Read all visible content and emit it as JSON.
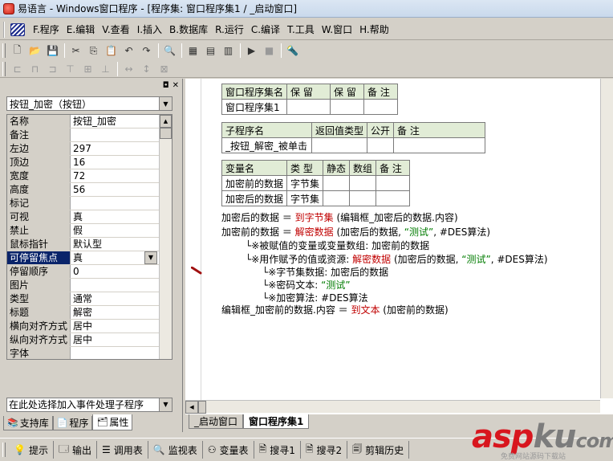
{
  "window": {
    "title": "易语言 - Windows窗口程序 - [程序集: 窗口程序集1 / _启动窗口]"
  },
  "menu": [
    "F.程序",
    "E.编辑",
    "V.查看",
    "I.插入",
    "B.数据库",
    "R.运行",
    "C.编译",
    "T.工具",
    "W.窗口",
    "H.帮助"
  ],
  "toolbar": {
    "row1": [
      "new-file-icon",
      "open-folder-icon",
      "save-icon",
      "cut-icon",
      "copy-icon",
      "paste-icon",
      "undo-icon",
      "redo-icon",
      "find-icon",
      "layout1-icon",
      "layout2-icon",
      "layout3-icon",
      "run-icon",
      "stop-icon",
      "debug-icon"
    ],
    "row1_glyphs": [
      "🗋",
      "📂",
      "💾",
      "✂",
      "⎘",
      "📋",
      "↶",
      "↷",
      "🔍",
      "▦",
      "▤",
      "▥",
      "▶",
      "■",
      "🔦"
    ],
    "row2": [
      "align-left-icon",
      "align-center-icon",
      "align-right-icon",
      "align-top-icon",
      "align-middle-icon",
      "align-bottom-icon",
      "same-width-icon",
      "same-height-icon",
      "same-size-icon"
    ],
    "row2_glyphs": [
      "⊏",
      "⊓",
      "⊐",
      "⊤",
      "⊞",
      "⊥",
      "↔",
      "↕",
      "⊠"
    ]
  },
  "left_panel": {
    "object_select": "按钮_加密（按钮）",
    "properties": [
      {
        "name": "名称",
        "value": "按钮_加密"
      },
      {
        "name": "备注",
        "value": ""
      },
      {
        "name": "左边",
        "value": "297"
      },
      {
        "name": "顶边",
        "value": "16"
      },
      {
        "name": "宽度",
        "value": "72"
      },
      {
        "name": "高度",
        "value": "56"
      },
      {
        "name": "标记",
        "value": ""
      },
      {
        "name": "可视",
        "value": "真"
      },
      {
        "name": "禁止",
        "value": "假"
      },
      {
        "name": "鼠标指针",
        "value": "默认型"
      },
      {
        "name": "可停留焦点",
        "value": "真",
        "selected": true
      },
      {
        "name": "  停留顺序",
        "value": "0"
      },
      {
        "name": "图片",
        "value": ""
      },
      {
        "name": "类型",
        "value": "通常"
      },
      {
        "name": "标题",
        "value": "解密"
      },
      {
        "name": "横向对齐方式",
        "value": "居中"
      },
      {
        "name": "纵向对齐方式",
        "value": "居中"
      },
      {
        "name": "字体",
        "value": ""
      }
    ],
    "event_select": "在此处选择加入事件处理子程序",
    "tabs": [
      {
        "label": "支持库",
        "icon": "library-icon",
        "glyph": "📚"
      },
      {
        "label": "程序",
        "icon": "program-icon",
        "glyph": "📄"
      },
      {
        "label": "属性",
        "icon": "property-icon",
        "glyph": "🗂"
      }
    ]
  },
  "code": {
    "table1": {
      "headers": [
        "窗口程序集名",
        "保 留",
        "保 留",
        "备 注"
      ],
      "row": [
        "窗口程序集1",
        "",
        "",
        ""
      ]
    },
    "table2": {
      "headers": [
        "子程序名",
        "返回值类型",
        "公开",
        "备 注"
      ],
      "row": [
        "_按钮_解密_被单击",
        "",
        "",
        ""
      ]
    },
    "table3": {
      "headers": [
        "变量名",
        "类 型",
        "静态",
        "数组",
        "备 注"
      ],
      "rows": [
        [
          "加密前的数据",
          "字节集",
          "",
          "",
          ""
        ],
        [
          "加密后的数据",
          "字节集",
          "",
          "",
          ""
        ]
      ]
    },
    "lines": [
      {
        "pre": "加密后的数据 ＝ ",
        "fn": "到字节集",
        "post": " (编辑框_加密后的数据.内容)"
      },
      {
        "pre": "加密前的数据 ＝ ",
        "fn": "解密数据",
        "post": " (加密后的数据, ",
        "str": "“测试”",
        "post2": ", #DES算法)"
      },
      {
        "tree": "└※被赋值的变量或变量数组: 加密前的数据"
      },
      {
        "tree": "└※用作赋予的值或资源: ",
        "fn": "解密数据",
        "post": " (加密后的数据, ",
        "str": "“测试”",
        "post2": ", #DES算法)"
      },
      {
        "tree": "※字节集数据: 加密后的数据"
      },
      {
        "tree": "※密码文本: ",
        "str": "“测试”"
      },
      {
        "tree": "※加密算法: #DES算法"
      },
      {
        "pre": "编辑框_加密前的数据.内容 ＝ ",
        "fn": "到文本",
        "post": " (加密前的数据)"
      }
    ],
    "tabs": [
      "_启动窗口",
      "窗口程序集1"
    ]
  },
  "bottom_tabs": [
    {
      "label": "提示",
      "icon": "tip-icon",
      "glyph": "💡"
    },
    {
      "label": "输出",
      "icon": "output-icon",
      "glyph": "🗔"
    },
    {
      "label": "调用表",
      "icon": "callstack-icon",
      "glyph": "☰"
    },
    {
      "label": "监视表",
      "icon": "watch-icon",
      "glyph": "🔍"
    },
    {
      "label": "变量表",
      "icon": "variable-icon",
      "glyph": "⚇"
    },
    {
      "label": "搜寻1",
      "icon": "search1-icon",
      "glyph": "🗎"
    },
    {
      "label": "搜寻2",
      "icon": "search2-icon",
      "glyph": "🗎"
    },
    {
      "label": "剪辑历史",
      "icon": "clip-history-icon",
      "glyph": "🗐"
    }
  ],
  "brand": {
    "asp": "asp",
    "ku": "ku",
    ".": ".",
    "com": "com",
    "tagline": "免费网站源码下载站"
  }
}
